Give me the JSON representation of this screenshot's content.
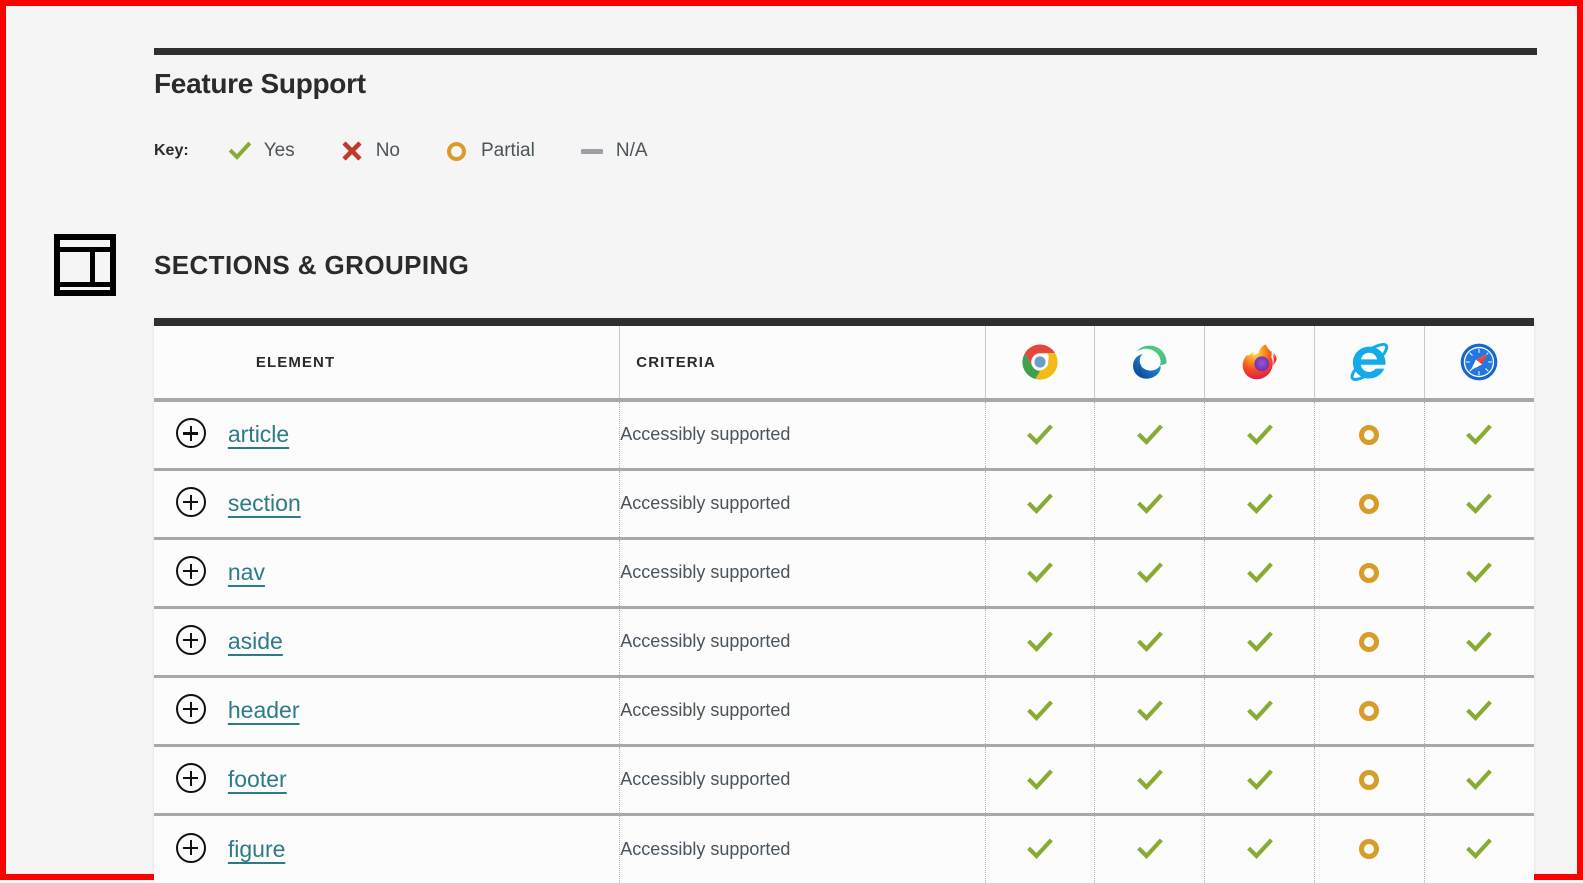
{
  "header": {
    "title": "Feature Support"
  },
  "key": {
    "label": "Key:",
    "items": [
      {
        "icon": "check-icon",
        "label": "Yes",
        "state": "yes"
      },
      {
        "icon": "x-icon",
        "label": "No",
        "state": "no"
      },
      {
        "icon": "circle-icon",
        "label": "Partial",
        "state": "partial"
      },
      {
        "icon": "dash-icon",
        "label": "N/A",
        "state": "na"
      }
    ]
  },
  "section": {
    "icon": "layout-sections-icon",
    "title": "SECTIONS & GROUPING"
  },
  "table": {
    "columns": {
      "element": "ELEMENT",
      "criteria": "CRITERIA"
    },
    "browsers": [
      {
        "name": "Chrome",
        "icon": "chrome-icon"
      },
      {
        "name": "Edge",
        "icon": "edge-icon"
      },
      {
        "name": "Firefox",
        "icon": "firefox-icon"
      },
      {
        "name": "Internet Explorer",
        "icon": "internet-explorer-icon"
      },
      {
        "name": "Safari",
        "icon": "safari-icon"
      }
    ],
    "rows": [
      {
        "expander": "+",
        "element": "article",
        "criteria": "Accessibly supported",
        "support": [
          "yes",
          "yes",
          "yes",
          "partial",
          "yes"
        ]
      },
      {
        "expander": "+",
        "element": "section",
        "criteria": "Accessibly supported",
        "support": [
          "yes",
          "yes",
          "yes",
          "partial",
          "yes"
        ]
      },
      {
        "expander": "+",
        "element": "nav",
        "criteria": "Accessibly supported",
        "support": [
          "yes",
          "yes",
          "yes",
          "partial",
          "yes"
        ]
      },
      {
        "expander": "+",
        "element": "aside",
        "criteria": "Accessibly supported",
        "support": [
          "yes",
          "yes",
          "yes",
          "partial",
          "yes"
        ]
      },
      {
        "expander": "+",
        "element": "header",
        "criteria": "Accessibly supported",
        "support": [
          "yes",
          "yes",
          "yes",
          "partial",
          "yes"
        ]
      },
      {
        "expander": "+",
        "element": "footer",
        "criteria": "Accessibly supported",
        "support": [
          "yes",
          "yes",
          "yes",
          "partial",
          "yes"
        ]
      },
      {
        "expander": "+",
        "element": "figure",
        "criteria": "Accessibly supported",
        "support": [
          "yes",
          "yes",
          "yes",
          "partial",
          "yes"
        ]
      }
    ]
  },
  "colors": {
    "yes": "#8aab33",
    "no": "#c0392b",
    "partial": "#d89d28",
    "na": "#9aa0a6",
    "link": "#2d7b87",
    "rule": "#2f2f2f",
    "page_background": "#f5f5f5"
  }
}
